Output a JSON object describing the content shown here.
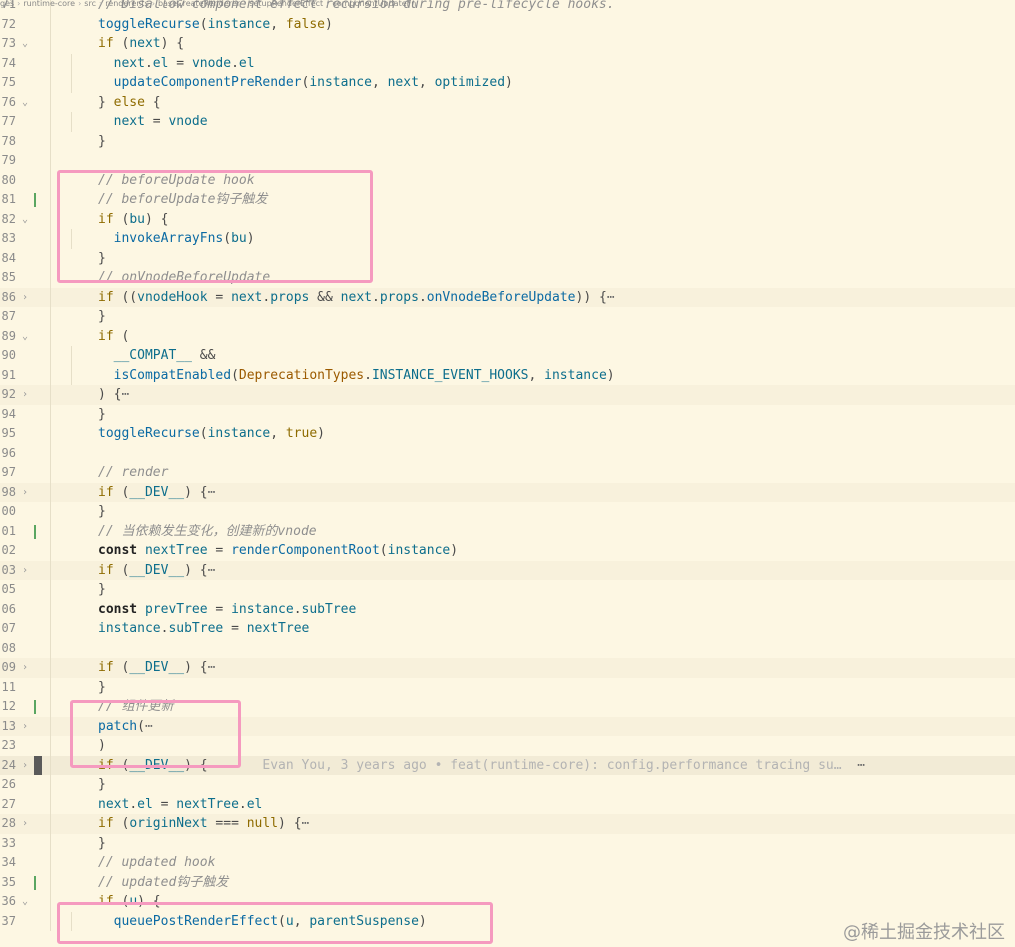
{
  "breadcrumb": [
    "ges",
    "runtime-core",
    "src",
    "renderer.ts",
    "baseCreateRenderer",
    "setupRenderEffect",
    "componentUpdateFn"
  ],
  "watermark": "@稀土掘金技术社区",
  "lines": [
    {
      "num": "71",
      "fold": "",
      "mark": "",
      "tokens": [
        [
          "cm",
          "// Disallow component effect recursion during pre-lifecycle hooks."
        ]
      ]
    },
    {
      "num": "72",
      "fold": "",
      "mark": "",
      "tokens": [
        [
          "fn",
          "toggleRecurse"
        ],
        [
          "p",
          "("
        ],
        [
          "var",
          "instance"
        ],
        [
          "p",
          ", "
        ],
        [
          "kw",
          "false"
        ],
        [
          "p",
          ")"
        ]
      ]
    },
    {
      "num": "73",
      "fold": "v",
      "mark": "",
      "tokens": [
        [
          "kw",
          "if"
        ],
        [
          "p",
          " ("
        ],
        [
          "var",
          "next"
        ],
        [
          "p",
          ") {"
        ]
      ]
    },
    {
      "num": "74",
      "fold": "",
      "mark": "",
      "tokens": [
        [
          "p",
          "  "
        ],
        [
          "var",
          "next"
        ],
        [
          "p",
          "."
        ],
        [
          "var",
          "el"
        ],
        [
          "p",
          " = "
        ],
        [
          "var",
          "vnode"
        ],
        [
          "p",
          "."
        ],
        [
          "var",
          "el"
        ]
      ]
    },
    {
      "num": "75",
      "fold": "",
      "mark": "",
      "tokens": [
        [
          "p",
          "  "
        ],
        [
          "fn",
          "updateComponentPreRender"
        ],
        [
          "p",
          "("
        ],
        [
          "var",
          "instance"
        ],
        [
          "p",
          ", "
        ],
        [
          "var",
          "next"
        ],
        [
          "p",
          ", "
        ],
        [
          "var",
          "optimized"
        ],
        [
          "p",
          ")"
        ]
      ]
    },
    {
      "num": "76",
      "fold": "v",
      "mark": "",
      "tokens": [
        [
          "p",
          "} "
        ],
        [
          "kw",
          "else"
        ],
        [
          "p",
          " {"
        ]
      ]
    },
    {
      "num": "77",
      "fold": "",
      "mark": "",
      "tokens": [
        [
          "p",
          "  "
        ],
        [
          "var",
          "next"
        ],
        [
          "p",
          " = "
        ],
        [
          "var",
          "vnode"
        ]
      ]
    },
    {
      "num": "78",
      "fold": "",
      "mark": "",
      "tokens": [
        [
          "p",
          "}"
        ]
      ]
    },
    {
      "num": "79",
      "fold": "",
      "mark": "",
      "tokens": []
    },
    {
      "num": "80",
      "fold": "",
      "mark": "",
      "tokens": [
        [
          "cm",
          "// beforeUpdate hook"
        ]
      ]
    },
    {
      "num": "81",
      "fold": "",
      "mark": "g",
      "tokens": [
        [
          "cm",
          "// beforeUpdate钩子触发"
        ]
      ]
    },
    {
      "num": "82",
      "fold": "v",
      "mark": "",
      "tokens": [
        [
          "kw",
          "if"
        ],
        [
          "p",
          " ("
        ],
        [
          "var",
          "bu"
        ],
        [
          "p",
          ") {"
        ]
      ]
    },
    {
      "num": "83",
      "fold": "",
      "mark": "",
      "tokens": [
        [
          "p",
          "  "
        ],
        [
          "fn",
          "invokeArrayFns"
        ],
        [
          "p",
          "("
        ],
        [
          "var",
          "bu"
        ],
        [
          "p",
          ")"
        ]
      ]
    },
    {
      "num": "84",
      "fold": "",
      "mark": "",
      "tokens": [
        [
          "p",
          "}"
        ]
      ]
    },
    {
      "num": "85",
      "fold": "",
      "mark": "",
      "tokens": [
        [
          "cm",
          "// onVnodeBeforeUpdate"
        ]
      ]
    },
    {
      "num": "86",
      "fold": ">",
      "mark": "",
      "folded": true,
      "tokens": [
        [
          "kw",
          "if"
        ],
        [
          "p",
          " (("
        ],
        [
          "var",
          "vnodeHook"
        ],
        [
          "p",
          " = "
        ],
        [
          "var",
          "next"
        ],
        [
          "p",
          "."
        ],
        [
          "var",
          "props"
        ],
        [
          "p",
          " && "
        ],
        [
          "var",
          "next"
        ],
        [
          "p",
          "."
        ],
        [
          "var",
          "props"
        ],
        [
          "p",
          "."
        ],
        [
          "fn",
          "onVnodeBeforeUpdate"
        ],
        [
          "p",
          ")) {"
        ],
        [
          "dot",
          "⋯"
        ]
      ]
    },
    {
      "num": "87",
      "fold": "",
      "mark": "",
      "tokens": [
        [
          "p",
          "}"
        ]
      ]
    },
    {
      "num": "89",
      "fold": "v",
      "mark": "",
      "tokens": [
        [
          "kw",
          "if"
        ],
        [
          "p",
          " ("
        ]
      ]
    },
    {
      "num": "90",
      "fold": "",
      "mark": "",
      "tokens": [
        [
          "p",
          "  "
        ],
        [
          "var",
          "__COMPAT__"
        ],
        [
          "p",
          " &&"
        ]
      ]
    },
    {
      "num": "91",
      "fold": "",
      "mark": "",
      "tokens": [
        [
          "p",
          "  "
        ],
        [
          "fn",
          "isCompatEnabled"
        ],
        [
          "p",
          "("
        ],
        [
          "ct",
          "DeprecationTypes"
        ],
        [
          "p",
          "."
        ],
        [
          "var",
          "INSTANCE_EVENT_HOOKS"
        ],
        [
          "p",
          ", "
        ],
        [
          "var",
          "instance"
        ],
        [
          "p",
          ")"
        ]
      ]
    },
    {
      "num": "92",
      "fold": ">",
      "mark": "",
      "folded": true,
      "tokens": [
        [
          "p",
          ") {"
        ],
        [
          "dot",
          "⋯"
        ]
      ]
    },
    {
      "num": "94",
      "fold": "",
      "mark": "",
      "tokens": [
        [
          "p",
          "}"
        ]
      ]
    },
    {
      "num": "95",
      "fold": "",
      "mark": "",
      "tokens": [
        [
          "fn",
          "toggleRecurse"
        ],
        [
          "p",
          "("
        ],
        [
          "var",
          "instance"
        ],
        [
          "p",
          ", "
        ],
        [
          "kw",
          "true"
        ],
        [
          "p",
          ")"
        ]
      ]
    },
    {
      "num": "96",
      "fold": "",
      "mark": "",
      "tokens": []
    },
    {
      "num": "97",
      "fold": "",
      "mark": "",
      "tokens": [
        [
          "cm",
          "// render"
        ]
      ]
    },
    {
      "num": "98",
      "fold": ">",
      "mark": "",
      "folded": true,
      "tokens": [
        [
          "kw",
          "if"
        ],
        [
          "p",
          " ("
        ],
        [
          "var",
          "__DEV__"
        ],
        [
          "p",
          ") {"
        ],
        [
          "dot",
          "⋯"
        ]
      ]
    },
    {
      "num": "00",
      "fold": "",
      "mark": "",
      "tokens": [
        [
          "p",
          "}"
        ]
      ]
    },
    {
      "num": "01",
      "fold": "",
      "mark": "g",
      "tokens": [
        [
          "cm",
          "// 当依赖发生变化，创建新的vnode"
        ]
      ]
    },
    {
      "num": "02",
      "fold": "",
      "mark": "",
      "tokens": [
        [
          "bold",
          "const"
        ],
        [
          "p",
          " "
        ],
        [
          "var",
          "nextTree"
        ],
        [
          "p",
          " = "
        ],
        [
          "fn",
          "renderComponentRoot"
        ],
        [
          "p",
          "("
        ],
        [
          "var",
          "instance"
        ],
        [
          "p",
          ")"
        ]
      ]
    },
    {
      "num": "03",
      "fold": ">",
      "mark": "",
      "folded": true,
      "tokens": [
        [
          "kw",
          "if"
        ],
        [
          "p",
          " ("
        ],
        [
          "var",
          "__DEV__"
        ],
        [
          "p",
          ") {"
        ],
        [
          "dot",
          "⋯"
        ]
      ]
    },
    {
      "num": "05",
      "fold": "",
      "mark": "",
      "tokens": [
        [
          "p",
          "}"
        ]
      ]
    },
    {
      "num": "06",
      "fold": "",
      "mark": "",
      "tokens": [
        [
          "bold",
          "const"
        ],
        [
          "p",
          " "
        ],
        [
          "var",
          "prevTree"
        ],
        [
          "p",
          " = "
        ],
        [
          "var",
          "instance"
        ],
        [
          "p",
          "."
        ],
        [
          "var",
          "subTree"
        ]
      ]
    },
    {
      "num": "07",
      "fold": "",
      "mark": "",
      "tokens": [
        [
          "var",
          "instance"
        ],
        [
          "p",
          "."
        ],
        [
          "var",
          "subTree"
        ],
        [
          "p",
          " = "
        ],
        [
          "var",
          "nextTree"
        ]
      ]
    },
    {
      "num": "08",
      "fold": "",
      "mark": "",
      "tokens": []
    },
    {
      "num": "09",
      "fold": ">",
      "mark": "",
      "folded": true,
      "tokens": [
        [
          "kw",
          "if"
        ],
        [
          "p",
          " ("
        ],
        [
          "var",
          "__DEV__"
        ],
        [
          "p",
          ") {"
        ],
        [
          "dot",
          "⋯"
        ]
      ]
    },
    {
      "num": "11",
      "fold": "",
      "mark": "",
      "tokens": [
        [
          "p",
          "}"
        ]
      ]
    },
    {
      "num": "12",
      "fold": "",
      "mark": "g",
      "tokens": [
        [
          "cm",
          "// 组件更新"
        ]
      ]
    },
    {
      "num": "13",
      "fold": ">",
      "mark": "",
      "folded": true,
      "tokens": [
        [
          "fn",
          "patch"
        ],
        [
          "p",
          "("
        ],
        [
          "dot",
          "⋯"
        ]
      ]
    },
    {
      "num": "23",
      "fold": "",
      "mark": "",
      "tokens": [
        [
          "p",
          ")"
        ]
      ]
    },
    {
      "num": "24",
      "fold": ">",
      "mark": "cur",
      "current": true,
      "tokens": [
        [
          "kw",
          "if"
        ],
        [
          "p",
          " ("
        ],
        [
          "var",
          "__DEV__"
        ],
        [
          "p",
          ") {"
        ],
        [
          "p",
          "       "
        ],
        [
          "lens",
          "Evan You, 3 years ago • feat(runtime-core): config.performance tracing su…"
        ],
        [
          "dot",
          "  ⋯"
        ]
      ]
    },
    {
      "num": "26",
      "fold": "",
      "mark": "",
      "tokens": [
        [
          "p",
          "}"
        ]
      ]
    },
    {
      "num": "27",
      "fold": "",
      "mark": "",
      "tokens": [
        [
          "var",
          "next"
        ],
        [
          "p",
          "."
        ],
        [
          "var",
          "el"
        ],
        [
          "p",
          " = "
        ],
        [
          "var",
          "nextTree"
        ],
        [
          "p",
          "."
        ],
        [
          "var",
          "el"
        ]
      ]
    },
    {
      "num": "28",
      "fold": ">",
      "mark": "",
      "folded": true,
      "tokens": [
        [
          "kw",
          "if"
        ],
        [
          "p",
          " ("
        ],
        [
          "var",
          "originNext"
        ],
        [
          "p",
          " === "
        ],
        [
          "kw",
          "null"
        ],
        [
          "p",
          ") {"
        ],
        [
          "dot",
          "⋯"
        ]
      ]
    },
    {
      "num": "33",
      "fold": "",
      "mark": "",
      "tokens": [
        [
          "p",
          "}"
        ]
      ]
    },
    {
      "num": "34",
      "fold": "",
      "mark": "",
      "tokens": [
        [
          "cm",
          "// updated hook"
        ]
      ]
    },
    {
      "num": "35",
      "fold": "",
      "mark": "g",
      "tokens": [
        [
          "cm",
          "// updated钩子触发"
        ]
      ]
    },
    {
      "num": "36",
      "fold": "v",
      "mark": "",
      "tokens": [
        [
          "kw",
          "if"
        ],
        [
          "p",
          " ("
        ],
        [
          "var",
          "u"
        ],
        [
          "p",
          ") {"
        ]
      ]
    },
    {
      "num": "37",
      "fold": "",
      "mark": "",
      "tokens": [
        [
          "p",
          "  "
        ],
        [
          "fn",
          "queuePostRenderEffect"
        ],
        [
          "p",
          "("
        ],
        [
          "var",
          "u"
        ],
        [
          "p",
          ", "
        ],
        [
          "var",
          "parentSuspense"
        ],
        [
          "p",
          ")"
        ]
      ]
    }
  ]
}
